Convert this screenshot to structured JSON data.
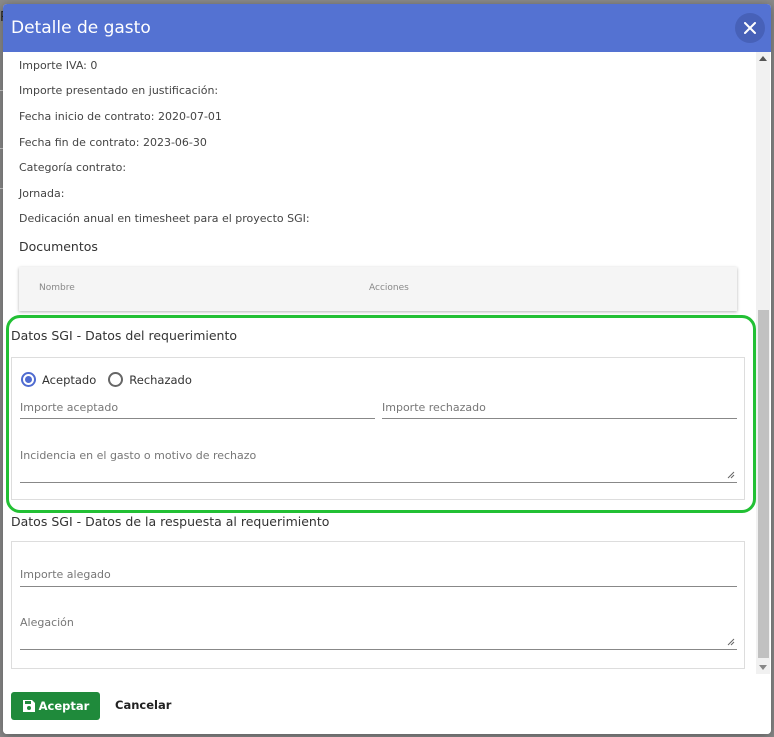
{
  "dialog": {
    "title": "Detalle de gasto"
  },
  "info": {
    "importe_iva": "Importe IVA: 0",
    "importe_presentado": "Importe presentado en justificación:",
    "fecha_inicio": "Fecha inicio de contrato: 2020-07-01",
    "fecha_fin": "Fecha fin de contrato: 2023-06-30",
    "categoria": "Categoría contrato:",
    "jornada": "Jornada:",
    "dedicacion": "Dedicación anual en timesheet para el proyecto SGI:"
  },
  "documentos": {
    "title": "Documentos",
    "columns": [
      "Nombre",
      "Acciones"
    ]
  },
  "requerimiento": {
    "title": "Datos SGI - Datos del requerimiento",
    "radio_aceptado": "Aceptado",
    "radio_rechazado": "Rechazado",
    "selected": "Aceptado",
    "importe_aceptado_label": "Importe aceptado",
    "importe_rechazado_label": "Importe rechazado",
    "incidencia_label": "Incidencia en el gasto o motivo de rechazo"
  },
  "respuesta": {
    "title": "Datos SGI - Datos de la respuesta al requerimiento",
    "importe_alegado_label": "Importe alegado",
    "alegacion_label": "Alegación"
  },
  "footer": {
    "accept_label": "Aceptar",
    "cancel_label": "Cancelar"
  },
  "colors": {
    "header": "#5472d2",
    "accept": "#1f8a3b",
    "highlight": "#22c034",
    "radio_accent": "#4f6bd0"
  }
}
